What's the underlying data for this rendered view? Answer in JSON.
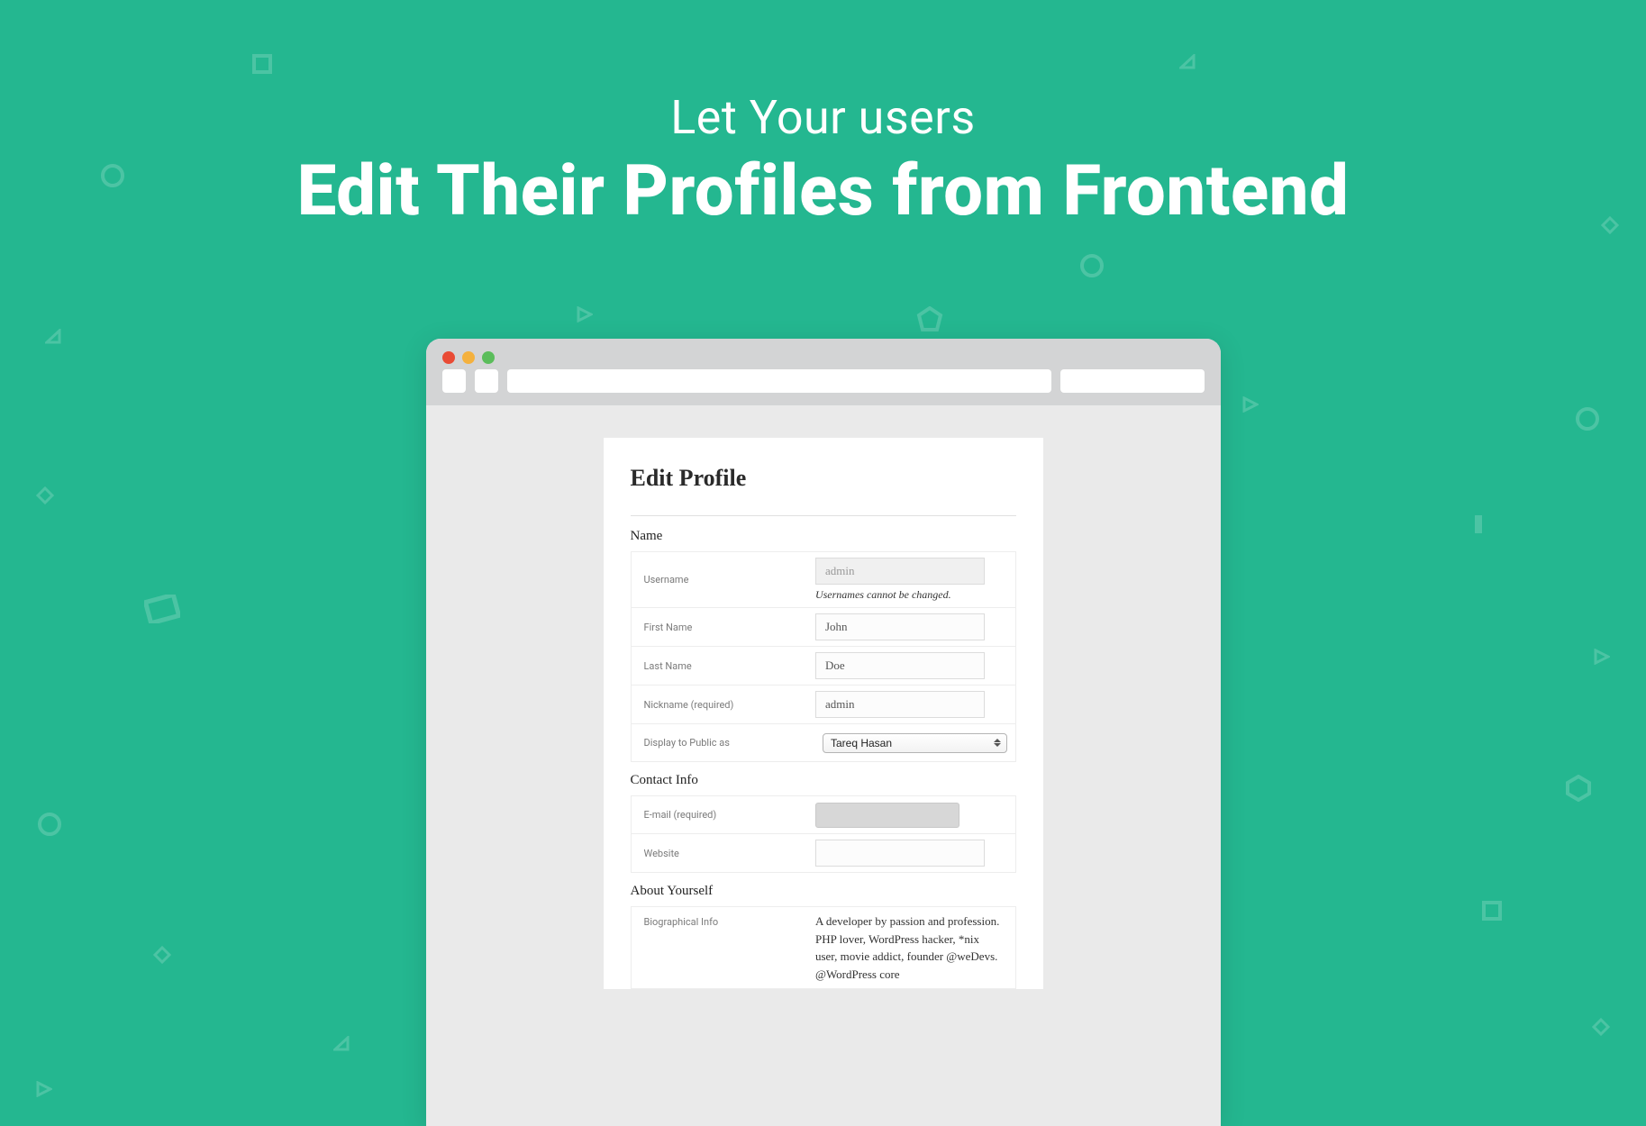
{
  "hero": {
    "subtitle": "Let Your users",
    "title": "Edit Their Profiles from Frontend"
  },
  "page": {
    "title": "Edit Profile",
    "sections": {
      "name_head": "Name",
      "contact_head": "Contact Info",
      "about_head": "About Yourself"
    },
    "labels": {
      "username": "Username",
      "first_name": "First Name",
      "last_name": "Last Name",
      "nickname": "Nickname (required)",
      "display": "Display to Public as",
      "email": "E-mail (required)",
      "website": "Website",
      "bio": "Biographical Info"
    },
    "values": {
      "username": "admin",
      "username_help": "Usernames cannot be changed.",
      "first_name": "John",
      "last_name": "Doe",
      "nickname": "admin",
      "display": "Tareq Hasan",
      "website": "",
      "bio": "A developer by passion and profession. PHP lover, WordPress hacker, *nix user, movie addict, founder @weDevs. @WordPress core"
    }
  }
}
